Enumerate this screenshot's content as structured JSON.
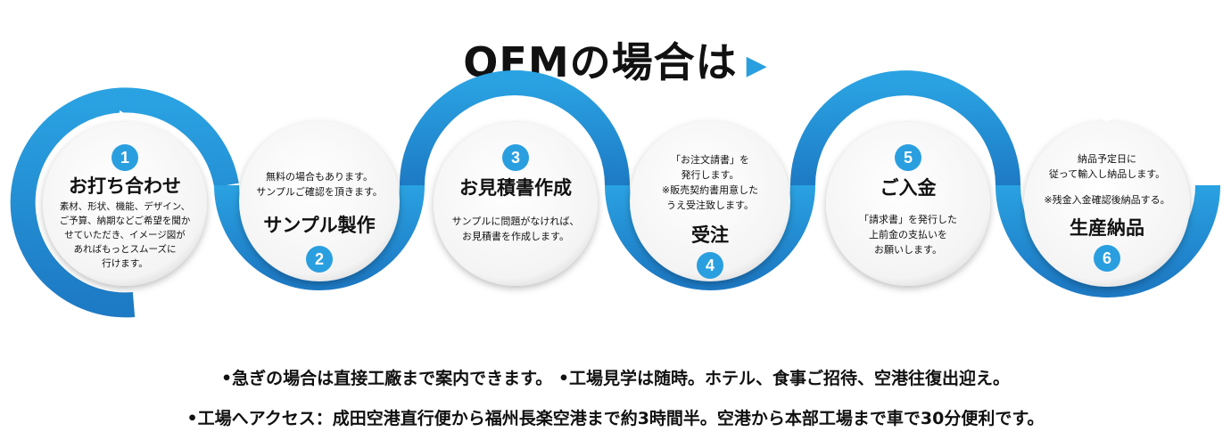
{
  "title": "OEMの場合は",
  "title_arrow": "▶",
  "colors": {
    "accent": "#2a9fe0",
    "ring_dark": "#1e78c2",
    "text": "#111111"
  },
  "steps": [
    {
      "number": "1",
      "title": "お打ち合わせ",
      "desc_lines": [
        "素材、形状、機能、デザイン、",
        "ご予算、納期などご希望を聞か",
        "せていただき、イメージ図が",
        "あればもっとスムーズに",
        "行けます。"
      ]
    },
    {
      "number": "2",
      "title": "サンプル製作",
      "desc_lines": [
        "無料の場合もあります。",
        "サンプルご確認を頂きます。"
      ]
    },
    {
      "number": "3",
      "title": "お見積書作成",
      "desc_lines": [
        "サンプルに問題がなければ、",
        "お見積書を作成します。"
      ]
    },
    {
      "number": "4",
      "title": "受注",
      "desc_lines": [
        "「お注文請書」を",
        "発行します。",
        "※販売契約書用意した",
        "うえ受注致します。"
      ]
    },
    {
      "number": "5",
      "title": "ご入金",
      "desc_lines": [
        "「請求書」を発行した",
        "上前金の支払いを",
        "お願いします。"
      ]
    },
    {
      "number": "6",
      "title": "生産納品",
      "desc_lines": [
        "納品予定日に",
        "従って輸入し納品します。",
        "※残金入金確認後納品する。"
      ]
    }
  ],
  "notes": [
    "•急ぎの場合は直接工廠まで案内できます。 •工場見学は随時。ホテル、食事ご招待、空港往復出迎え。",
    "•工場へアクセス：成田空港直行便から福州長楽空港まで約3時間半。空港から本部工場まで車で30分便利です。"
  ]
}
